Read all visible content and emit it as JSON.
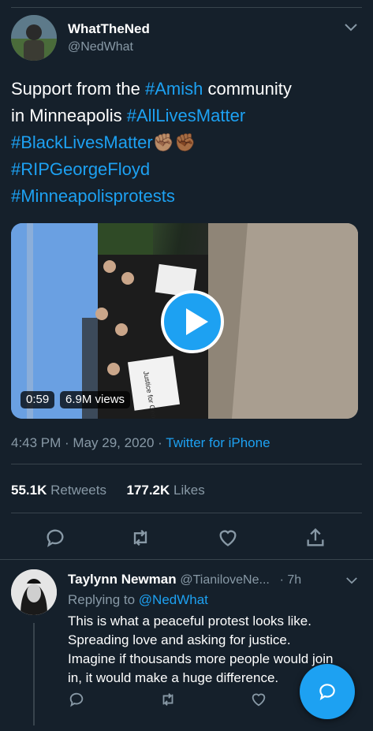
{
  "tweet": {
    "author_name": "WhatTheNed",
    "author_handle": "@NedWhat",
    "text_line1_plain": "Support from the ",
    "text_line1_tag": "#Amish",
    "text_line1_end": " community",
    "text_line2_plain": "in Minneapolis ",
    "text_line2_tag": "#AllLivesMatter",
    "text_line3_tag": "#BlackLivesMatter",
    "text_line3_emoji": "✊🏽✊🏾",
    "text_line4_tag": "#RIPGeorgeFloyd",
    "text_line5_tag": "#Minneapolisprotests",
    "video": {
      "duration": "0:59",
      "views": "6.9M views",
      "sign_text": "Justice for George Floyd"
    },
    "time": "4:43 PM",
    "date": "May 29, 2020",
    "separator": " · ",
    "source": "Twitter for iPhone",
    "retweets_count": "55.1K",
    "retweets_label": "Retweets",
    "likes_count": "177.2K",
    "likes_label": "Likes"
  },
  "reply": {
    "author_name": "Taylynn Newman",
    "author_handle": "@TianiloveNe...",
    "time": "· 7h",
    "replying_label": "Replying to ",
    "replying_handle": "@NedWhat",
    "line1": "This is what a peaceful protest looks like.",
    "line2": "Spreading love and asking for justice.",
    "line3": "Imagine if thousands more people would join",
    "line4": "in, it would make a huge difference."
  },
  "icons": [
    "chevron-down-icon",
    "reply-icon",
    "retweet-icon",
    "like-icon",
    "share-icon",
    "compose-icon"
  ],
  "colors": {
    "background": "#15202b",
    "accent": "#1da1f2",
    "muted": "#8899a6",
    "divider": "#38444d"
  }
}
